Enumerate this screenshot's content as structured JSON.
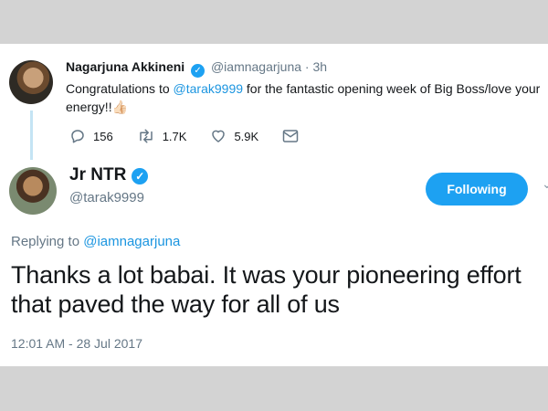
{
  "parent_tweet": {
    "author_name": "Nagarjuna Akkineni",
    "verified_glyph": "✓",
    "handle": "@iamnagarjuna",
    "separator": "·",
    "time": "3h",
    "text_before": "Congratulations to ",
    "mention": "@tarak9999",
    "text_after": " for the fantastic opening week of Big Boss/love your energy!!",
    "emoji": "👍🏻",
    "actions": {
      "replies": "156",
      "retweets": "1.7K",
      "likes": "5.9K"
    },
    "icons": [
      "reply-icon",
      "retweet-icon",
      "like-icon",
      "message-icon"
    ]
  },
  "main_tweet": {
    "author_name": "Jr NTR",
    "verified_glyph": "✓",
    "handle": "@tarak9999",
    "follow_label": "Following",
    "caret": "⌄",
    "replying_prefix": "Replying to ",
    "replying_to": "@iamnagarjuna",
    "text": "Thanks a lot babai. It was your pioneering effort that paved the way for all of us",
    "timestamp": "12:01 AM - 28 Jul 2017"
  },
  "colors": {
    "accent": "#1da1f2",
    "mention": "#1b95e0",
    "muted": "#657786",
    "background": "#d3d3d3",
    "thread_line": "#c4e4f4"
  }
}
